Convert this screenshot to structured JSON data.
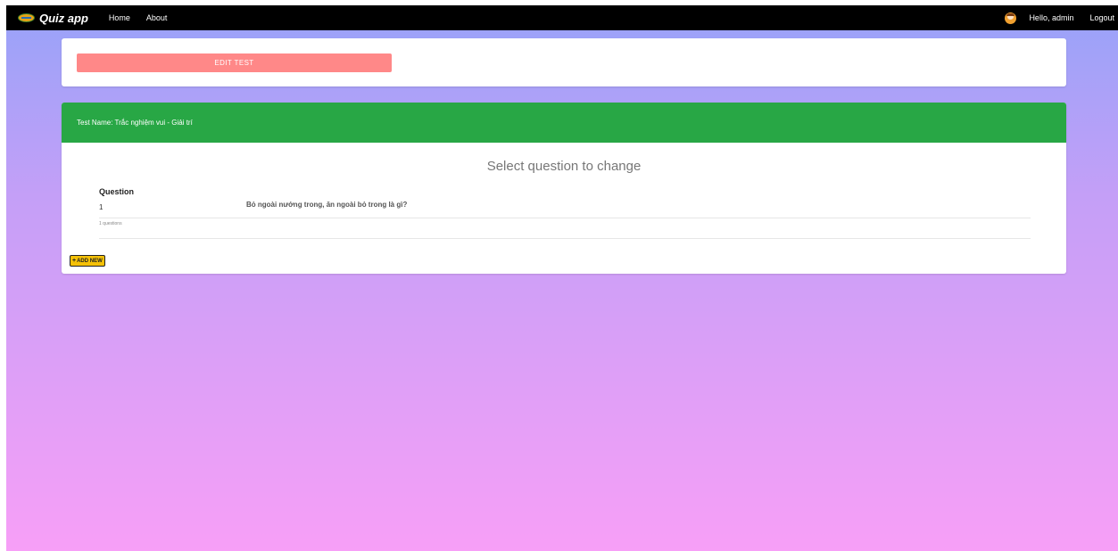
{
  "navbar": {
    "brand": "Quiz app",
    "links": [
      "Home",
      "About"
    ],
    "greeting": "Hello, admin",
    "logout": "Logout"
  },
  "top_card": {
    "edit_button": "EDIT TEST"
  },
  "test": {
    "name_line": "Test Name: Trắc nghiệm vui - Giải trí",
    "title": "Select question to change",
    "column_header": "Question",
    "questions": [
      {
        "number": "1",
        "text": "Bỏ ngoài nướng trong, ăn ngoài bỏ trong là gì?"
      }
    ],
    "count_text": "1 questions",
    "add_button": "ADD NEW"
  },
  "colors": {
    "navbar": "#000000",
    "edit_button": "#ff8888",
    "header": "#28a745",
    "add_button": "#f5c107",
    "gradient_top": "#97a3f9",
    "gradient_bottom": "#f79ff7"
  }
}
